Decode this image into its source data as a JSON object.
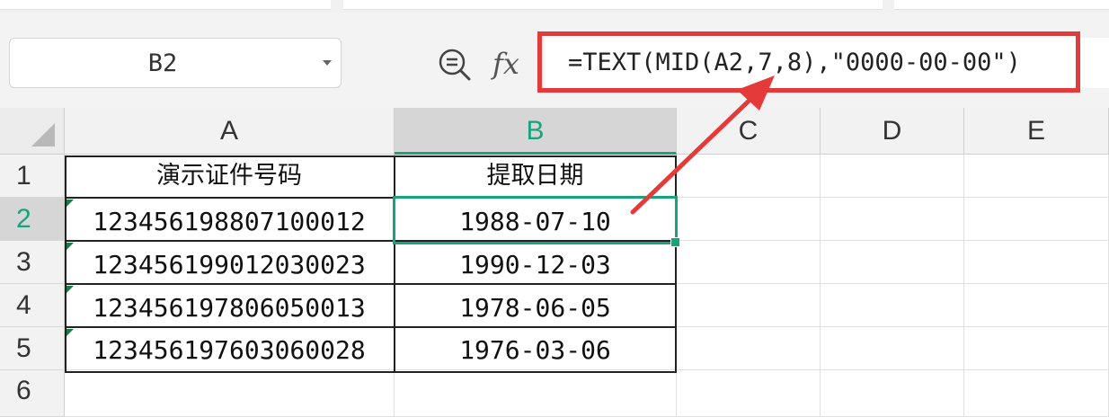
{
  "name_box": {
    "value": "B2"
  },
  "formula_bar": {
    "fx_label": "fx",
    "formula": "=TEXT(MID(A2,7,8),\"0000-00-00\")"
  },
  "columns": [
    "A",
    "B",
    "C",
    "D",
    "E"
  ],
  "rows": [
    "1",
    "2",
    "3",
    "4",
    "5",
    "6"
  ],
  "cells": {
    "A1": "演示证件号码",
    "B1": "提取日期",
    "A2": "123456198807100012",
    "B2": "1988-07-10",
    "A3": "123456199012030023",
    "B3": "1990-12-03",
    "A4": "123456197806050013",
    "B4": "1978-06-05",
    "A5": "123456197603060028",
    "B5": "1976-03-06"
  },
  "selected_cell": "B2",
  "colors": {
    "accent": "#17a37b",
    "annotation": "#e53a3a"
  },
  "icons": {
    "zoom": "zoom-formula-icon",
    "dropdown": "chevron-down-icon",
    "select_all": "select-all-icon"
  }
}
